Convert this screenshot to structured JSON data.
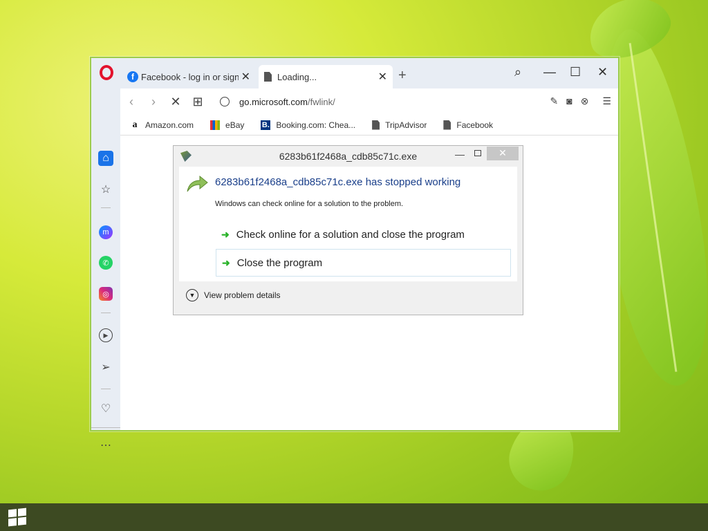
{
  "browser": {
    "tabs": [
      {
        "label": "Facebook - log in or sign u",
        "icon": "facebook-icon"
      },
      {
        "label": "Loading...",
        "icon": "page-icon"
      }
    ],
    "address": {
      "domain": "go.microsoft.com",
      "path": "/fwlink/"
    },
    "bookmarks": [
      {
        "label": "Amazon.com",
        "icon": "amazon-icon"
      },
      {
        "label": "eBay",
        "icon": "ebay-icon"
      },
      {
        "label": "Booking.com: Chea...",
        "icon": "booking-icon"
      },
      {
        "label": "TripAdvisor",
        "icon": "page-icon"
      },
      {
        "label": "Facebook",
        "icon": "page-icon"
      }
    ],
    "sidebar": [
      "home-icon",
      "bookmarks-icon",
      "messenger-icon",
      "whatsapp-icon",
      "instagram-icon",
      "player-icon",
      "send-icon",
      "heart-icon",
      "more-icon"
    ]
  },
  "dialog": {
    "title": "6283b61f2468a_cdb85c71c.exe",
    "heading": "6283b61f2468a_cdb85c71c.exe has stopped working",
    "subtext": "Windows can check online for a solution to the problem.",
    "option1": "Check online for a solution and close the program",
    "option2": "Close the program",
    "details": "View problem details"
  },
  "colors": {
    "accent": "#1a73e8",
    "opera_red": "#e3132d",
    "dialog_heading": "#1a3f8a"
  }
}
